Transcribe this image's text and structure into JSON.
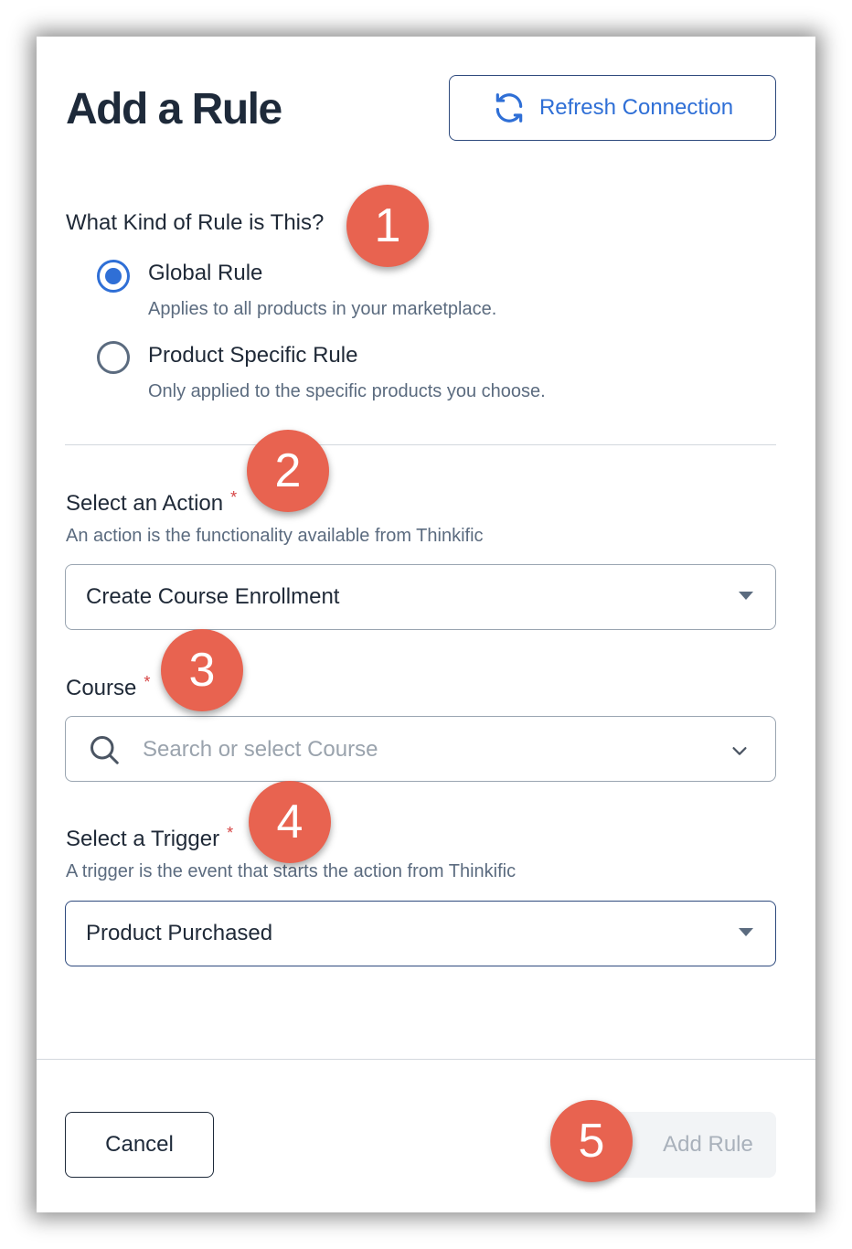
{
  "header": {
    "title": "Add a Rule",
    "refresh_label": "Refresh Connection",
    "refresh_icon": "refresh-icon"
  },
  "rule_type": {
    "question": "What Kind of Rule is This?",
    "options": [
      {
        "label": "Global Rule",
        "description": "Applies to all products in your marketplace.",
        "selected": true
      },
      {
        "label": "Product Specific Rule",
        "description": "Only applied to the specific products you choose.",
        "selected": false
      }
    ]
  },
  "action": {
    "label": "Select an Action",
    "required_mark": "*",
    "hint": "An action is the functionality available from Thinkific",
    "value": "Create Course Enrollment"
  },
  "course": {
    "label": "Course",
    "required_mark": "*",
    "placeholder": "Search or select Course",
    "value": ""
  },
  "trigger": {
    "label": "Select a Trigger",
    "required_mark": "*",
    "hint": "A trigger is the event that starts the action from Thinkific",
    "value": "Product Purchased"
  },
  "footer": {
    "cancel_label": "Cancel",
    "add_label": "Add Rule",
    "add_disabled": true
  },
  "callouts": [
    "1",
    "2",
    "3",
    "4",
    "5"
  ],
  "colors": {
    "accent": "#2f6fd6",
    "title": "#1e2a3a",
    "required": "#d64545",
    "callout": "#e86350",
    "disabled_text": "#a9b1bb"
  }
}
